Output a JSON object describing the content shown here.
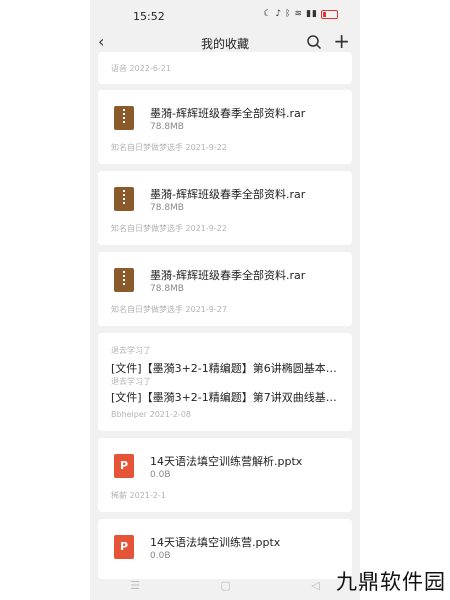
{
  "status_bar": {
    "time": "15:52"
  },
  "header": {
    "title": "我的收藏"
  },
  "first_item": {
    "meta": "语音 2022-6-21"
  },
  "items": [
    {
      "name": "墨漪-辉辉班级春季全部资料.rar",
      "size": "78.8MB",
      "meta": "知名自日梦做梦选手 2021-9-22",
      "type": "rar"
    },
    {
      "name": "墨漪-辉辉班级春季全部资料.rar",
      "size": "78.8MB",
      "meta": "知名自日梦做梦选手 2021-9-22",
      "type": "rar"
    },
    {
      "name": "墨漪-辉辉班级春季全部资料.rar",
      "size": "78.8MB",
      "meta": "知名自日梦做梦选手 2021-9-27",
      "type": "rar"
    }
  ],
  "chat_item": {
    "note1": "退去学习了",
    "line1": "[文件]【墨漪3+2-1精编题】第6讲椭圆基本…",
    "note2": "退去学习了",
    "line2": "[文件]【墨漪3+2-1精编题】第7讲双曲线基…",
    "meta": "Bbhelper 2021-2-08"
  },
  "ppt_items": [
    {
      "name": "14天语法填空训练营解析.pptx",
      "size": "0.0B",
      "meta": "稀薪 2021-2-1",
      "icon": "P"
    },
    {
      "name": "14天语法填空训练营.pptx",
      "size": "0.0B",
      "icon": "P"
    }
  ],
  "watermark": "九鼎软件园"
}
